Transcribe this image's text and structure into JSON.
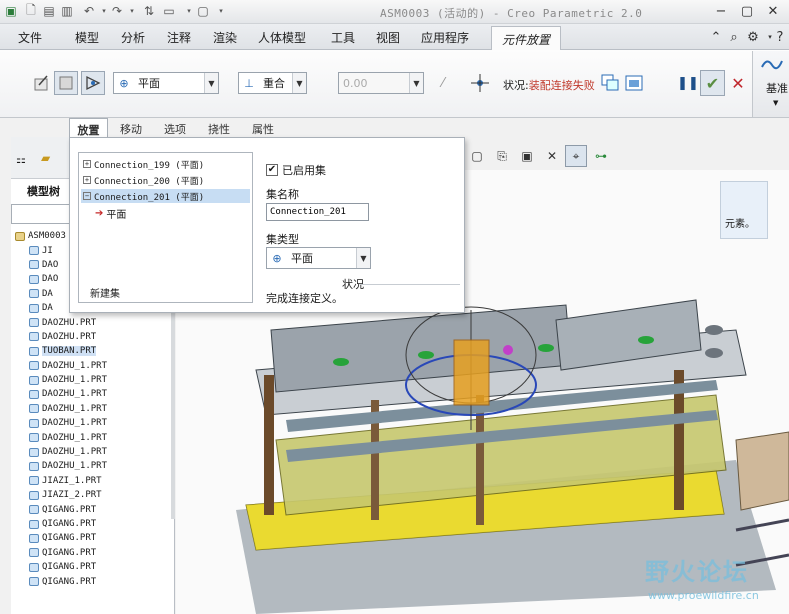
{
  "window": {
    "title": "ASM0003 (活动的) - Creo Parametric 2.0"
  },
  "quick_access": {
    "icons": [
      "app-logo-icon",
      "new-icon",
      "open-icon",
      "save-icon",
      "undo-icon",
      "redo-icon",
      "regenerate-icon",
      "window-icon",
      "close-window-icon",
      "customize-icon"
    ]
  },
  "menu": {
    "tabs": [
      "文件",
      "模型",
      "分析",
      "注释",
      "渲染",
      "人体模型",
      "工具",
      "视图",
      "应用程序"
    ],
    "active_tab": "元件放置"
  },
  "ribbon": {
    "constraint_type": "平面",
    "alignment": "重合",
    "offset_value": "0.00",
    "status_label": "状况:",
    "status_value": "装配连接失败",
    "datum_label": "基准"
  },
  "subtabs": [
    "放置",
    "移动",
    "选项",
    "挠性",
    "属性"
  ],
  "placement": {
    "sets": [
      {
        "label": "Connection_199 (平面)",
        "expander": "+"
      },
      {
        "label": "Connection_200 (平面)",
        "expander": "+"
      },
      {
        "label": "Connection_201 (平面)",
        "expander": "−"
      }
    ],
    "child_item": "平面",
    "new_set": "新建集",
    "enabled_set": "已启用集",
    "set_name_label": "集名称",
    "set_name_value": "Connection_201",
    "set_type_label": "集类型",
    "set_type_value": "平面",
    "status_title": "状况",
    "status_text": "完成连接定义。"
  },
  "model_tree": {
    "title": "模型树",
    "root": "ASM0003",
    "items": [
      "JI",
      "DAO",
      "DAO",
      "DA",
      "DA",
      "DAOZHU.PRT",
      "DAOZHU.PRT",
      "TUOBAN.PRT",
      "DAOZHU_1.PRT",
      "DAOZHU_1.PRT",
      "DAOZHU_1.PRT",
      "DAOZHU_1.PRT",
      "DAOZHU_1.PRT",
      "DAOZHU_1.PRT",
      "DAOZHU_1.PRT",
      "DAOZHU_1.PRT",
      "JIAZI_1.PRT",
      "JIAZI_2.PRT",
      "QIGANG.PRT",
      "QIGANG.PRT",
      "QIGANG.PRT",
      "QIGANG.PRT",
      "QIGANG.PRT",
      "QIGANG.PRT"
    ],
    "highlighted_index": 7
  },
  "message": "元素。",
  "watermark": {
    "text": "野火论坛",
    "url": "www.proewildfire.cn"
  }
}
